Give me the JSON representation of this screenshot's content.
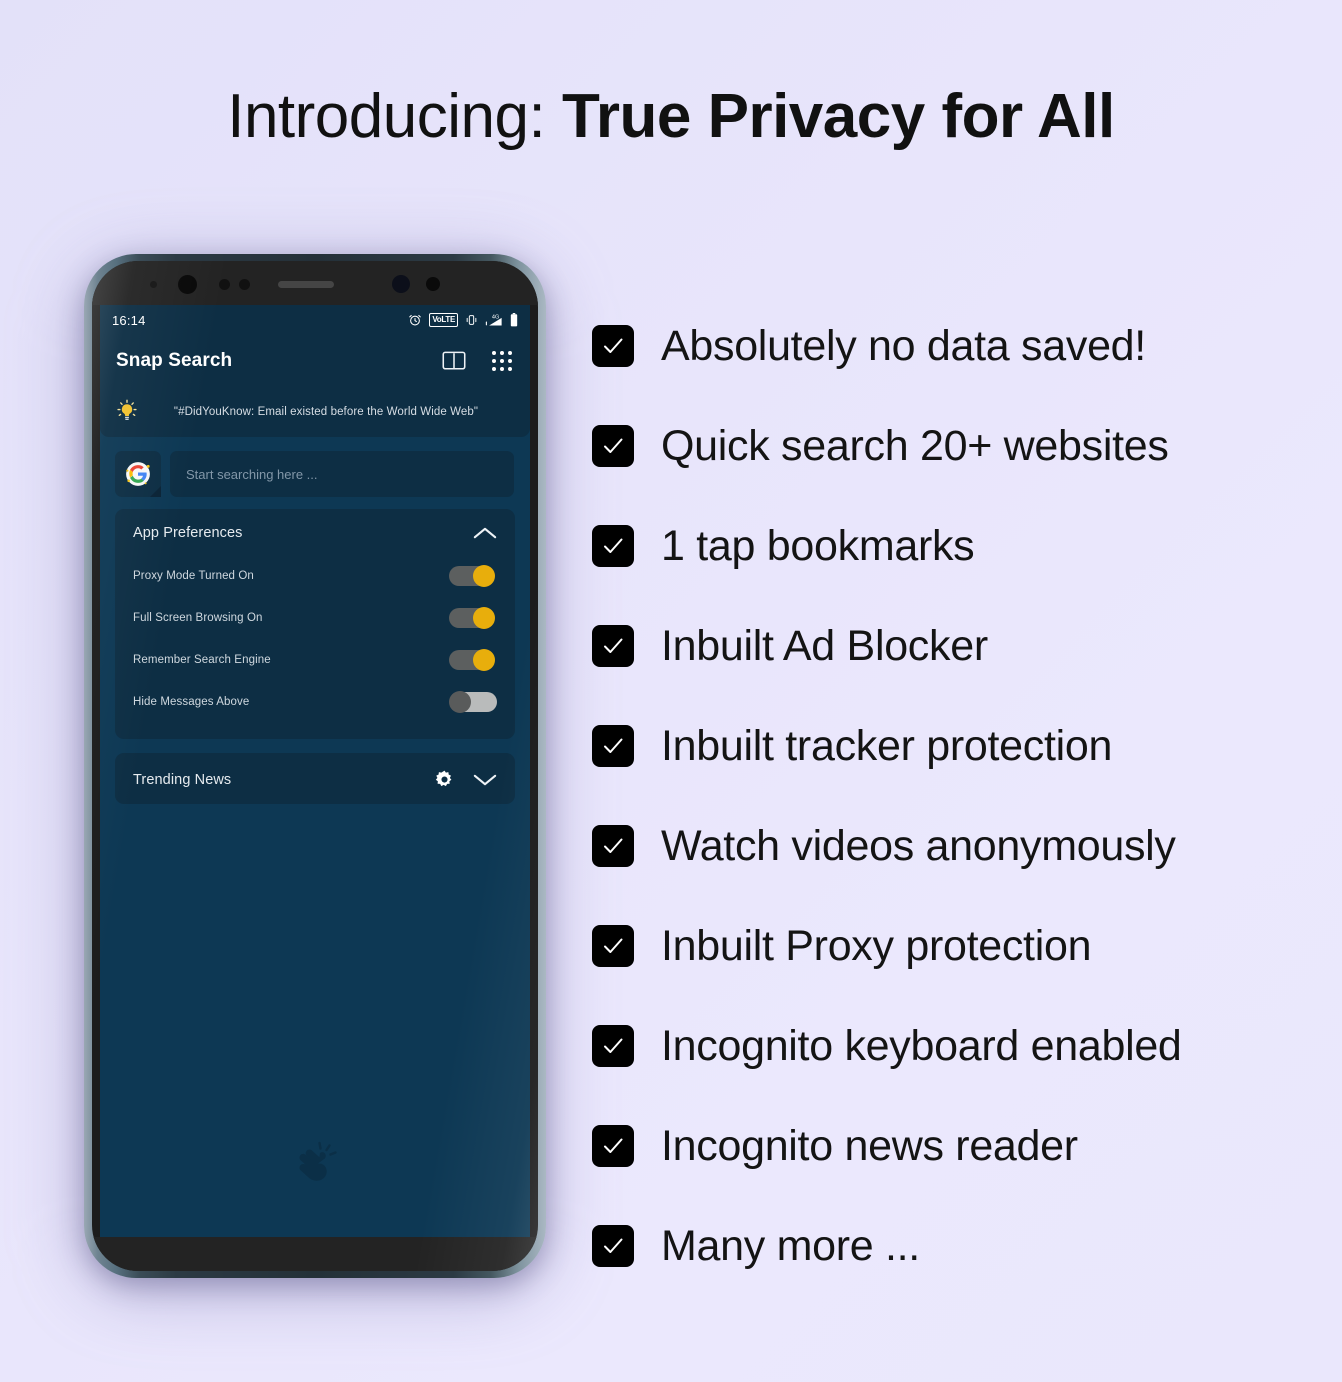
{
  "headline": {
    "prefix": "Introducing: ",
    "emphasis": "True Privacy for All"
  },
  "colors": {
    "page_background": "#e8e5fb",
    "phone_screen": "#0d3854",
    "card": "#0d2e44",
    "toggle_on": "#e8ae0c",
    "toggle_off": "#595b5b",
    "checkbox": "#000000",
    "heading_text": "#111111"
  },
  "phone": {
    "statusbar": {
      "time": "16:14",
      "icons": [
        {
          "name": "alarm-icon"
        },
        {
          "name": "volte-icon",
          "label": "VoLTE"
        },
        {
          "name": "vibrate-icon"
        },
        {
          "name": "signal-4g-icon",
          "label": "4G"
        },
        {
          "name": "battery-icon"
        }
      ]
    },
    "appbar": {
      "title": "Snap Search",
      "actions": [
        {
          "name": "bookmarks-icon"
        },
        {
          "name": "apps-grid-icon"
        }
      ]
    },
    "tip_banner": {
      "icon": "lightbulb-icon",
      "text": "\"#DidYouKnow: Email existed before the World Wide Web\""
    },
    "search": {
      "engine_icon": "google-icon",
      "placeholder": "Start searching here ...",
      "value": ""
    },
    "cards": [
      {
        "title": "App Preferences",
        "collapse_icon": "chevron-up-icon",
        "expanded": true,
        "preferences": [
          {
            "label": "Proxy Mode Turned On",
            "on": true
          },
          {
            "label": "Full Screen Browsing On",
            "on": true
          },
          {
            "label": "Remember Search Engine",
            "on": true
          },
          {
            "label": "Hide Messages Above",
            "on": false
          }
        ]
      },
      {
        "title": "Trending News",
        "settings_icon": "gear-icon",
        "collapse_icon": "chevron-down-icon",
        "expanded": false,
        "preferences": []
      }
    ],
    "watermark_icon": "snap-fingers-icon"
  },
  "features": [
    {
      "label": "Absolutely no data saved!",
      "checked": true
    },
    {
      "label": "Quick search 20+ websites",
      "checked": true
    },
    {
      "label": "1 tap bookmarks",
      "checked": true
    },
    {
      "label": "Inbuilt Ad Blocker",
      "checked": true
    },
    {
      "label": "Inbuilt tracker protection",
      "checked": true
    },
    {
      "label": "Watch videos anonymously",
      "checked": true
    },
    {
      "label": "Inbuilt Proxy protection",
      "checked": true
    },
    {
      "label": "Incognito keyboard enabled",
      "checked": true
    },
    {
      "label": "Incognito news reader",
      "checked": true
    },
    {
      "label": "Many more ...",
      "checked": true
    }
  ]
}
